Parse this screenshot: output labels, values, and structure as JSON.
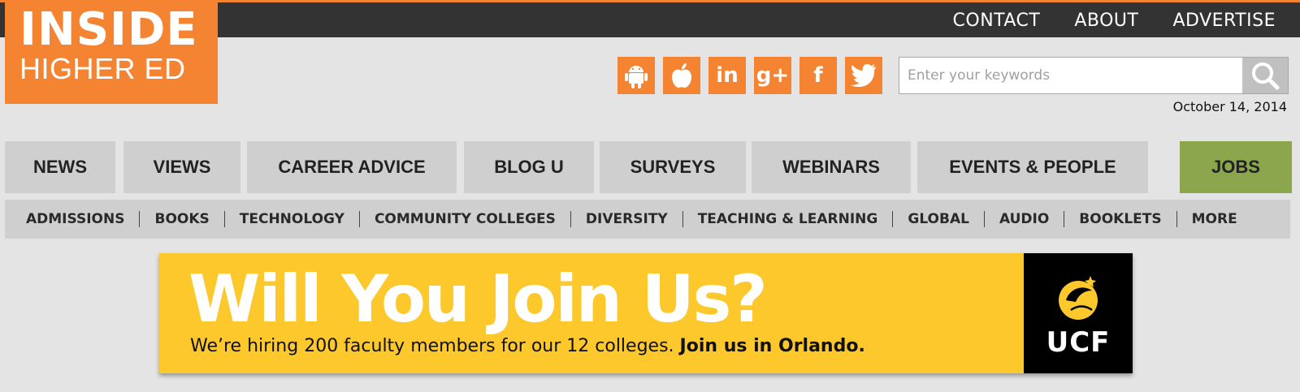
{
  "colors": {
    "brand_orange": "#f58432",
    "topbar": "#333333",
    "jobs_green": "#8ca64e",
    "banner_yellow": "#fcc82c"
  },
  "logo": {
    "line1": "INSIDE",
    "line2": "HIGHER ED"
  },
  "top_nav": [
    "CONTACT",
    "ABOUT",
    "ADVERTISE"
  ],
  "social": [
    {
      "name": "android-icon"
    },
    {
      "name": "apple-icon"
    },
    {
      "name": "linkedin-icon",
      "glyph": "in"
    },
    {
      "name": "google-plus-icon",
      "glyph": "g+"
    },
    {
      "name": "facebook-icon",
      "glyph": "f"
    },
    {
      "name": "twitter-icon"
    }
  ],
  "search": {
    "placeholder": "Enter your keywords",
    "value": ""
  },
  "date": "October 14, 2014",
  "main_nav": [
    "NEWS",
    "VIEWS",
    "CAREER ADVICE",
    "BLOG U",
    "SURVEYS",
    "WEBINARS",
    "EVENTS & PEOPLE",
    "JOBS"
  ],
  "sub_nav": [
    "ADMISSIONS",
    "BOOKS",
    "TECHNOLOGY",
    "COMMUNITY COLLEGES",
    "DIVERSITY",
    "TEACHING & LEARNING",
    "GLOBAL",
    "AUDIO",
    "BOOKLETS",
    "MORE"
  ],
  "ad": {
    "headline": "Will You Join Us?",
    "text_regular": "We’re hiring 200 faculty members for our 12 colleges.",
    "text_bold": "Join us in Orlando.",
    "logo_text": "UCF"
  }
}
